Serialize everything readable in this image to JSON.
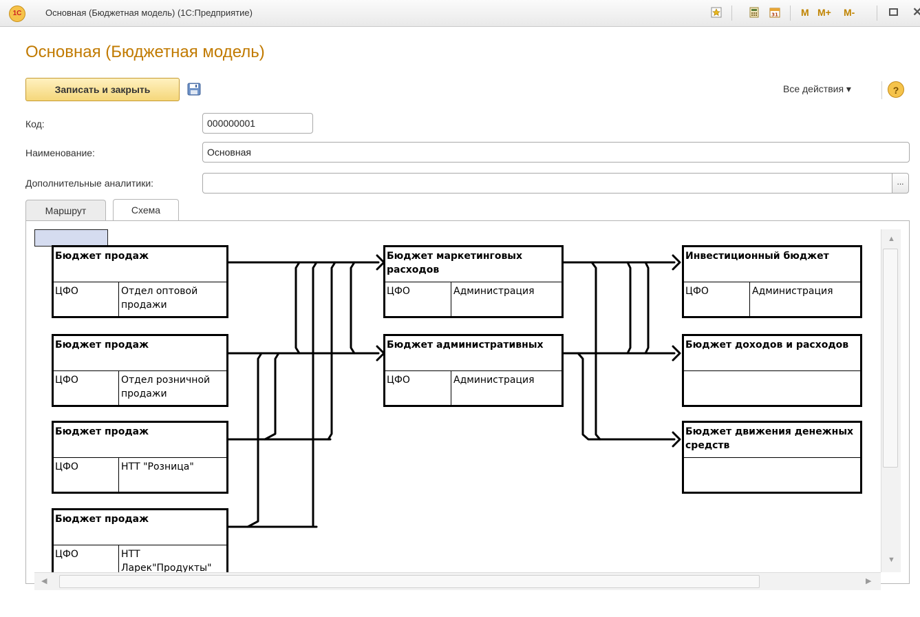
{
  "window": {
    "title": "Основная (Бюджетная модель)  (1С:Предприятие)",
    "logo_text": "1С",
    "toolbar_icons": [
      "favorites-icon",
      "calculator-icon",
      "calendar-icon"
    ],
    "memory_buttons": [
      "M",
      "M+",
      "M-"
    ]
  },
  "form": {
    "title": "Основная (Бюджетная модель)",
    "save_close_label": "Записать и закрыть",
    "all_actions_label": "Все действия ▾",
    "help_label": "?"
  },
  "fields": {
    "code": {
      "label": "Код:",
      "value": "000000001"
    },
    "name": {
      "label": "Наименование:",
      "value": "Основная"
    },
    "analytics": {
      "label": "Дополнительные аналитики:",
      "value": "",
      "button": "..."
    }
  },
  "tabs": [
    {
      "label": "Маршрут",
      "active": false
    },
    {
      "label": "Схема",
      "active": true
    }
  ],
  "diagram": {
    "nodes": [
      {
        "id": "sales1",
        "title": "Бюджет продаж",
        "cfo_label": "ЦФО",
        "cfo_value": "Отдел оптовой продажи"
      },
      {
        "id": "sales2",
        "title": "Бюджет продаж",
        "cfo_label": "ЦФО",
        "cfo_value": "Отдел розничной продажи"
      },
      {
        "id": "sales3",
        "title": "Бюджет продаж",
        "cfo_label": "ЦФО",
        "cfo_value": "НТТ \"Розница\""
      },
      {
        "id": "sales4",
        "title": "Бюджет продаж",
        "cfo_label": "ЦФО",
        "cfo_value": "НТТ Ларек\"Продукты\""
      },
      {
        "id": "marketing",
        "title": "Бюджет маркетинговых расходов",
        "cfo_label": "ЦФО",
        "cfo_value": "Администрация"
      },
      {
        "id": "admin",
        "title": "Бюджет административных",
        "cfo_label": "ЦФО",
        "cfo_value": "Администрация"
      },
      {
        "id": "invest",
        "title": "Инвестиционный бюджет",
        "cfo_label": "ЦФО",
        "cfo_value": "Администрация"
      },
      {
        "id": "income",
        "title": "Бюджет доходов и расходов",
        "cfo_label": "",
        "cfo_value": ""
      },
      {
        "id": "cashflow",
        "title": "Бюджет движения денежных средств",
        "cfo_label": "",
        "cfo_value": ""
      }
    ]
  },
  "colors": {
    "accent_title": "#c17a00",
    "button_fill": "#f5d77a",
    "connector": "#000000"
  }
}
